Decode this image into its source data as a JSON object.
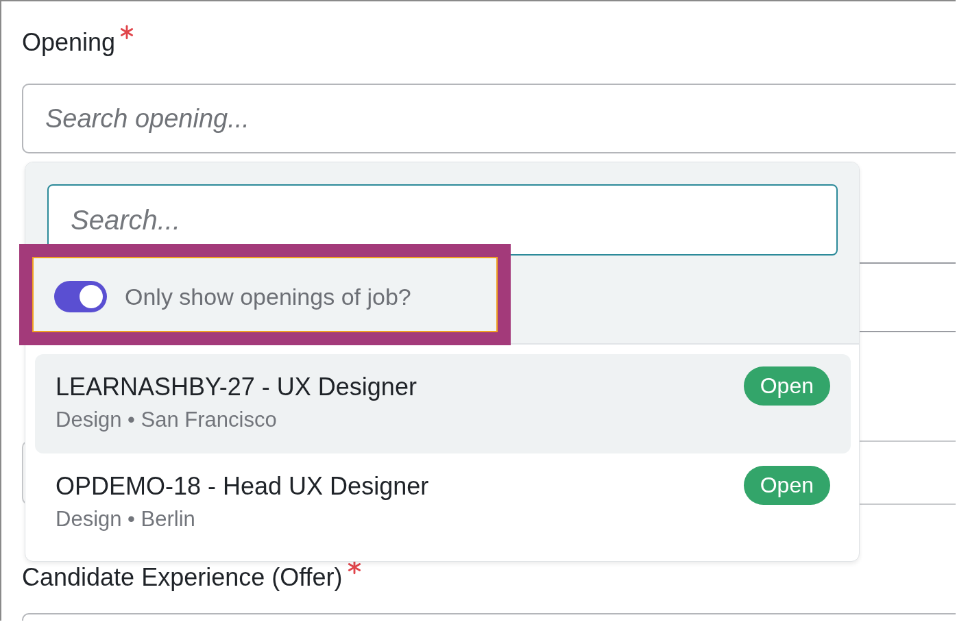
{
  "opening_field": {
    "label": "Opening",
    "required": true,
    "placeholder": "Search opening..."
  },
  "dropdown": {
    "search_placeholder": "Search...",
    "toggle": {
      "label": "Only show openings of job?",
      "on": true
    },
    "options": [
      {
        "title": "LEARNASHBY-27 - UX Designer",
        "meta": "Design • San Francisco",
        "status": "Open",
        "highlighted": true
      },
      {
        "title": "OPDEMO-18 - Head UX Designer",
        "meta": "Design • Berlin",
        "status": "Open",
        "highlighted": false
      }
    ]
  },
  "next_field": {
    "label": "Candidate Experience (Offer)",
    "required": true
  }
}
